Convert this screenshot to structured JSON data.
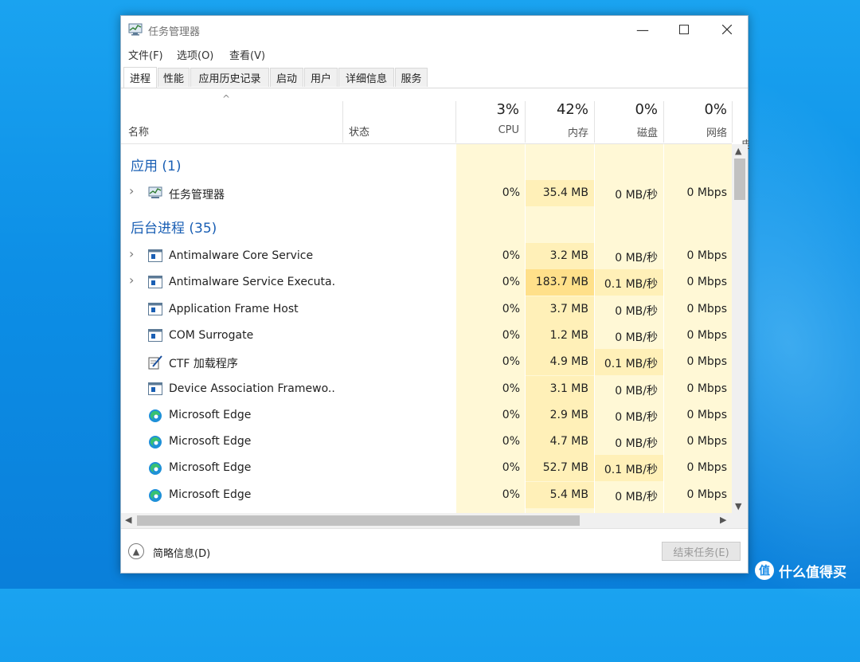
{
  "window": {
    "title": "任务管理器"
  },
  "menu": [
    {
      "label": "文件(F)"
    },
    {
      "label": "选项(O)"
    },
    {
      "label": "查看(V)"
    }
  ],
  "tabs": [
    {
      "label": "进程",
      "active": true
    },
    {
      "label": "性能"
    },
    {
      "label": "应用历史记录"
    },
    {
      "label": "启动"
    },
    {
      "label": "用户"
    },
    {
      "label": "详细信息"
    },
    {
      "label": "服务"
    }
  ],
  "headers": {
    "sort_caret": "^",
    "name": "名称",
    "status": "状态",
    "cpu": {
      "pct": "3%",
      "label": "CPU"
    },
    "memory": {
      "pct": "42%",
      "label": "内存"
    },
    "disk": {
      "pct": "0%",
      "label": "磁盘"
    },
    "network": {
      "pct": "0%",
      "label": "网络"
    },
    "power_partial": "电"
  },
  "groups": {
    "apps": "应用 (1)",
    "background": "后台进程 (35)"
  },
  "apps": [
    {
      "name": "任务管理器",
      "icon": "task-manager-icon",
      "expandable": true,
      "cpu": "0%",
      "memory": "35.4 MB",
      "disk": "0 MB/秒",
      "network": "0 Mbps"
    }
  ],
  "background": [
    {
      "name": "Antimalware Core Service",
      "icon": "service-window-icon",
      "expandable": true,
      "cpu": "0%",
      "memory": "3.2 MB",
      "disk": "0 MB/秒",
      "network": "0 Mbps"
    },
    {
      "name": "Antimalware Service Executa...",
      "icon": "service-window-icon",
      "expandable": true,
      "cpu": "0%",
      "memory": "183.7 MB",
      "disk": "0.1 MB/秒",
      "network": "0 Mbps"
    },
    {
      "name": "Application Frame Host",
      "icon": "service-window-icon",
      "expandable": false,
      "cpu": "0%",
      "memory": "3.7 MB",
      "disk": "0 MB/秒",
      "network": "0 Mbps"
    },
    {
      "name": "COM Surrogate",
      "icon": "service-window-icon",
      "expandable": false,
      "cpu": "0%",
      "memory": "1.2 MB",
      "disk": "0 MB/秒",
      "network": "0 Mbps"
    },
    {
      "name": "CTF 加载程序",
      "icon": "ctf-pen-icon",
      "expandable": false,
      "cpu": "0%",
      "memory": "4.9 MB",
      "disk": "0.1 MB/秒",
      "network": "0 Mbps"
    },
    {
      "name": "Device Association Framewo...",
      "icon": "service-window-icon",
      "expandable": false,
      "cpu": "0%",
      "memory": "3.1 MB",
      "disk": "0 MB/秒",
      "network": "0 Mbps"
    },
    {
      "name": "Microsoft Edge",
      "icon": "edge-icon",
      "expandable": false,
      "cpu": "0%",
      "memory": "2.9 MB",
      "disk": "0 MB/秒",
      "network": "0 Mbps"
    },
    {
      "name": "Microsoft Edge",
      "icon": "edge-icon",
      "expandable": false,
      "cpu": "0%",
      "memory": "4.7 MB",
      "disk": "0 MB/秒",
      "network": "0 Mbps"
    },
    {
      "name": "Microsoft Edge",
      "icon": "edge-icon",
      "expandable": false,
      "cpu": "0%",
      "memory": "52.7 MB",
      "disk": "0.1 MB/秒",
      "network": "0 Mbps"
    },
    {
      "name": "Microsoft Edge",
      "icon": "edge-icon",
      "expandable": false,
      "cpu": "0%",
      "memory": "5.4 MB",
      "disk": "0 MB/秒",
      "network": "0 Mbps"
    }
  ],
  "footer": {
    "fewer_details": "简略信息(D)",
    "end_task": "结束任务(E)"
  },
  "watermark": {
    "badge": "值",
    "text": "什么值得买"
  },
  "colors": {
    "heat_light": "#fff8d6",
    "heat_mid": "#fff0b8",
    "heat_strong": "#ffe08a",
    "group_title": "#1a5fb4",
    "desktop": "#0d8fe6"
  }
}
